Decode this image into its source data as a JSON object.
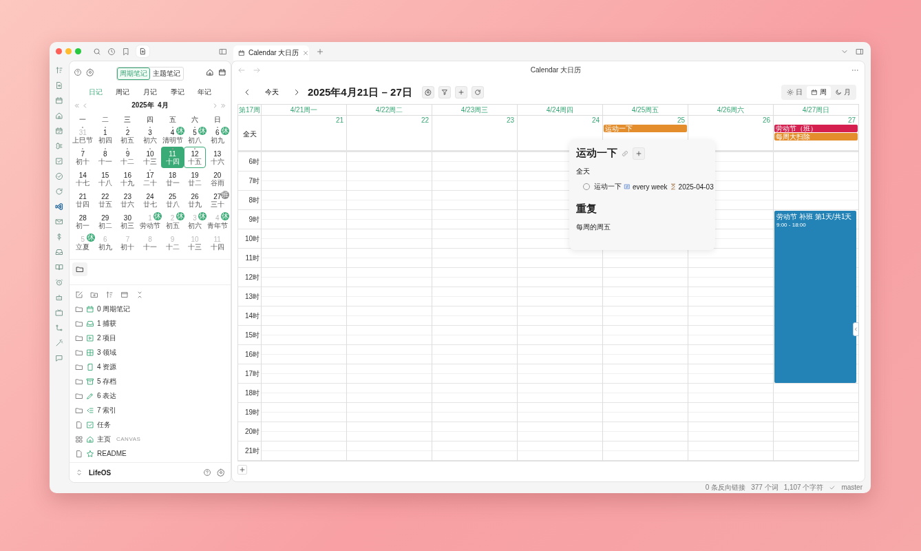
{
  "tab": {
    "title": "Calendar 大日历"
  },
  "sidebar": {
    "note_tabs": [
      {
        "label": "周期笔记",
        "selected": true
      },
      {
        "label": "主题笔记",
        "selected": false
      }
    ],
    "period_tabs": [
      {
        "label": "日记",
        "selected": true
      },
      {
        "label": "周记",
        "selected": false
      },
      {
        "label": "月记",
        "selected": false
      },
      {
        "label": "季记",
        "selected": false
      },
      {
        "label": "年记",
        "selected": false
      }
    ],
    "month_title": "2025年  4月",
    "weekdays": [
      "一",
      "二",
      "三",
      "四",
      "五",
      "六",
      "日"
    ],
    "weeks": [
      [
        {
          "day": "31",
          "sub": "上巳节",
          "muted": true,
          "dot": true,
          "today": false,
          "selected": false
        },
        {
          "day": "1",
          "sub": "初四",
          "muted": false,
          "dot": true,
          "today": false,
          "selected": false
        },
        {
          "day": "2",
          "sub": "初五",
          "muted": false,
          "dot": true,
          "today": false,
          "selected": false
        },
        {
          "day": "3",
          "sub": "初六",
          "muted": false,
          "dot": true,
          "today": false,
          "selected": false
        },
        {
          "day": "4",
          "sub": "清明节",
          "muted": false,
          "dot": true,
          "today": false,
          "selected": false,
          "badge": {
            "text": "休",
            "color": "#3aaa76"
          }
        },
        {
          "day": "5",
          "sub": "初八",
          "muted": false,
          "dot": true,
          "today": false,
          "selected": false,
          "badge": {
            "text": "休",
            "color": "#3aaa76"
          }
        },
        {
          "day": "6",
          "sub": "初九",
          "muted": false,
          "dot": true,
          "today": false,
          "selected": false,
          "badge": {
            "text": "休",
            "color": "#3aaa76"
          }
        }
      ],
      [
        {
          "day": "7",
          "sub": "初十",
          "muted": false,
          "dot": true,
          "today": false,
          "selected": false
        },
        {
          "day": "8",
          "sub": "十一",
          "muted": false,
          "dot": true,
          "today": false,
          "selected": false
        },
        {
          "day": "9",
          "sub": "十二",
          "muted": false,
          "dot": true,
          "today": false,
          "selected": false
        },
        {
          "day": "10",
          "sub": "十三",
          "muted": false,
          "dot": true,
          "today": false,
          "selected": false
        },
        {
          "day": "11",
          "sub": "十四",
          "muted": false,
          "dot": true,
          "today": true,
          "selected": false
        },
        {
          "day": "12",
          "sub": "十五",
          "muted": false,
          "dot": true,
          "today": false,
          "selected": true
        },
        {
          "day": "13",
          "sub": "十六",
          "muted": false,
          "dot": false,
          "today": false,
          "selected": false
        }
      ],
      [
        {
          "day": "14",
          "sub": "十七",
          "muted": false,
          "dot": false,
          "today": false,
          "selected": false
        },
        {
          "day": "15",
          "sub": "十八",
          "muted": false,
          "dot": false,
          "today": false,
          "selected": false
        },
        {
          "day": "16",
          "sub": "十九",
          "muted": false,
          "dot": false,
          "today": false,
          "selected": false
        },
        {
          "day": "17",
          "sub": "二十",
          "muted": false,
          "dot": true,
          "today": false,
          "selected": false
        },
        {
          "day": "18",
          "sub": "廿一",
          "muted": false,
          "dot": false,
          "today": false,
          "selected": false
        },
        {
          "day": "19",
          "sub": "廿二",
          "muted": false,
          "dot": false,
          "today": false,
          "selected": false
        },
        {
          "day": "20",
          "sub": "谷雨",
          "muted": false,
          "dot": false,
          "today": false,
          "selected": false
        }
      ],
      [
        {
          "day": "21",
          "sub": "廿四",
          "muted": false,
          "dot": false,
          "today": false,
          "selected": false
        },
        {
          "day": "22",
          "sub": "廿五",
          "muted": false,
          "dot": false,
          "today": false,
          "selected": false
        },
        {
          "day": "23",
          "sub": "廿六",
          "muted": false,
          "dot": false,
          "today": false,
          "selected": false
        },
        {
          "day": "24",
          "sub": "廿七",
          "muted": false,
          "dot": false,
          "today": false,
          "selected": false
        },
        {
          "day": "25",
          "sub": "廿八",
          "muted": false,
          "dot": false,
          "today": false,
          "selected": false
        },
        {
          "day": "26",
          "sub": "廿九",
          "muted": false,
          "dot": false,
          "today": false,
          "selected": false
        },
        {
          "day": "27",
          "sub": "三十",
          "muted": false,
          "dot": false,
          "today": false,
          "selected": false,
          "badge": {
            "text": "班",
            "color": "#8a8a8a"
          }
        }
      ],
      [
        {
          "day": "28",
          "sub": "初一",
          "muted": false,
          "dot": false,
          "today": false,
          "selected": false
        },
        {
          "day": "29",
          "sub": "初二",
          "muted": false,
          "dot": false,
          "today": false,
          "selected": false
        },
        {
          "day": "30",
          "sub": "初三",
          "muted": false,
          "dot": false,
          "today": false,
          "selected": false
        },
        {
          "day": "1",
          "sub": "劳动节",
          "muted": true,
          "dot": false,
          "today": false,
          "selected": false,
          "badge": {
            "text": "休",
            "color": "#3aaa76"
          }
        },
        {
          "day": "2",
          "sub": "初五",
          "muted": true,
          "dot": false,
          "today": false,
          "selected": false,
          "badge": {
            "text": "休",
            "color": "#3aaa76"
          }
        },
        {
          "day": "3",
          "sub": "初六",
          "muted": true,
          "dot": false,
          "today": false,
          "selected": false,
          "badge": {
            "text": "休",
            "color": "#3aaa76"
          }
        },
        {
          "day": "4",
          "sub": "青年节",
          "muted": true,
          "dot": false,
          "today": false,
          "selected": false,
          "badge": {
            "text": "休",
            "color": "#3aaa76"
          }
        }
      ],
      [
        {
          "day": "5",
          "sub": "立夏",
          "muted": true,
          "dot": false,
          "today": false,
          "selected": false,
          "badge": {
            "text": "休",
            "color": "#3aaa76"
          }
        },
        {
          "day": "6",
          "sub": "初九",
          "muted": true,
          "dot": false,
          "today": false,
          "selected": false
        },
        {
          "day": "7",
          "sub": "初十",
          "muted": true,
          "dot": false,
          "today": false,
          "selected": false
        },
        {
          "day": "8",
          "sub": "十一",
          "muted": true,
          "dot": false,
          "today": false,
          "selected": false
        },
        {
          "day": "9",
          "sub": "十二",
          "muted": true,
          "dot": false,
          "today": false,
          "selected": false
        },
        {
          "day": "10",
          "sub": "十三",
          "muted": true,
          "dot": false,
          "today": false,
          "selected": false
        },
        {
          "day": "11",
          "sub": "十四",
          "muted": true,
          "dot": false,
          "today": false,
          "selected": false
        }
      ]
    ],
    "files": [
      {
        "kind": "folder",
        "label": "0 周期笔记"
      },
      {
        "kind": "folder",
        "label": "1 捕获"
      },
      {
        "kind": "folder",
        "label": "2 项目"
      },
      {
        "kind": "folder",
        "label": "3 领域"
      },
      {
        "kind": "folder",
        "label": "4 资源"
      },
      {
        "kind": "folder",
        "label": "5 存档"
      },
      {
        "kind": "folder",
        "label": "6 表达"
      },
      {
        "kind": "folder",
        "label": "7 索引"
      },
      {
        "kind": "file",
        "label": "任务"
      },
      {
        "kind": "canvas",
        "label": "主页",
        "tag": "CANVAS"
      },
      {
        "kind": "file",
        "label": "README"
      }
    ],
    "vault": "LifeOS"
  },
  "main": {
    "title": "Calendar 大日历",
    "today_button": "今天",
    "range_title": "2025年4月21日 – 27日",
    "views": [
      {
        "label": "日",
        "selected": false
      },
      {
        "label": "周",
        "selected": true
      },
      {
        "label": "月",
        "selected": false
      }
    ],
    "week_label": "第17周",
    "all_day_label": "全天",
    "days": [
      {
        "header": "4/21周一",
        "date": "21"
      },
      {
        "header": "4/22周二",
        "date": "22"
      },
      {
        "header": "4/23周三",
        "date": "23"
      },
      {
        "header": "4/24周四",
        "date": "24"
      },
      {
        "header": "4/25周五",
        "date": "25",
        "all_day": [
          {
            "title": "运动一下",
            "color": "#e38d2c"
          }
        ]
      },
      {
        "header": "4/26周六",
        "date": "26"
      },
      {
        "header": "4/27周日",
        "date": "27",
        "all_day": [
          {
            "title": "劳动节（班）",
            "color": "#d41f4f"
          },
          {
            "title": "每周大扫除",
            "color": "#e38d2c"
          }
        ],
        "timed": [
          {
            "title": "劳动节 补班 第1天/共1天",
            "time": "9:00 - 18:00",
            "color": "#2383b7"
          }
        ]
      }
    ],
    "hours": [
      "6时",
      "7时",
      "8时",
      "9时",
      "10时",
      "11时",
      "12时",
      "13时",
      "14时",
      "15时",
      "16时",
      "17时",
      "18时",
      "19时",
      "20时",
      "21时"
    ],
    "popup": {
      "title": "运动一下",
      "section": "全天",
      "task": {
        "checked": false,
        "text": "运动一下",
        "recurrence": "every week",
        "date": "2025-04-03"
      },
      "heading": "重复",
      "text": "每周的周五"
    }
  },
  "status_bar": {
    "backlinks": "0 条反向链接",
    "words": "377 个词",
    "chars": "1,107 个字符",
    "branch": "master"
  }
}
